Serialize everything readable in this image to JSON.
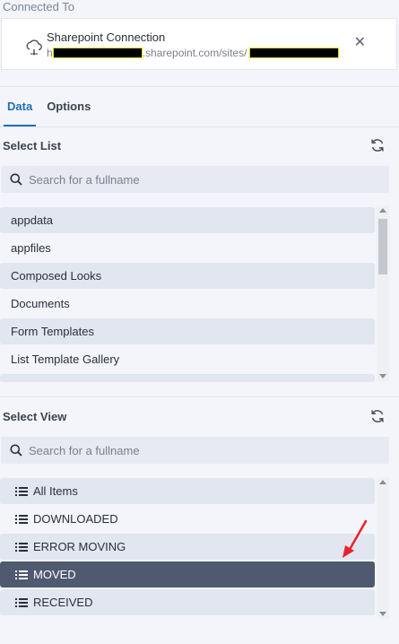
{
  "connection": {
    "label": "Connected To",
    "title": "Sharepoint Connection",
    "url_prefix": "h",
    "url_mid": ".sharepoint.com/sites/",
    "close_glyph": "✕"
  },
  "tabs": [
    {
      "label": "Data",
      "active": true
    },
    {
      "label": "Options",
      "active": false
    }
  ],
  "select_list": {
    "title": "Select List",
    "search_placeholder": "Search for a fullname",
    "items": [
      "appdata",
      "appfiles",
      "Composed Looks",
      "Documents",
      "Form Templates",
      "List Template Gallery"
    ]
  },
  "select_view": {
    "title": "Select View",
    "search_placeholder": "Search for a fullname",
    "items": [
      "All Items",
      "DOWNLOADED",
      "ERROR MOVING",
      "MOVED",
      "RECEIVED"
    ],
    "selected": "MOVED"
  },
  "colors": {
    "accent": "#1f6fb3",
    "selected_row": "#4f5a70",
    "annotation_arrow": "#e8232a"
  },
  "icons": [
    "cloud-link-icon",
    "close-icon",
    "refresh-icon",
    "search-icon",
    "list-icon",
    "red-arrow-annotation"
  ]
}
